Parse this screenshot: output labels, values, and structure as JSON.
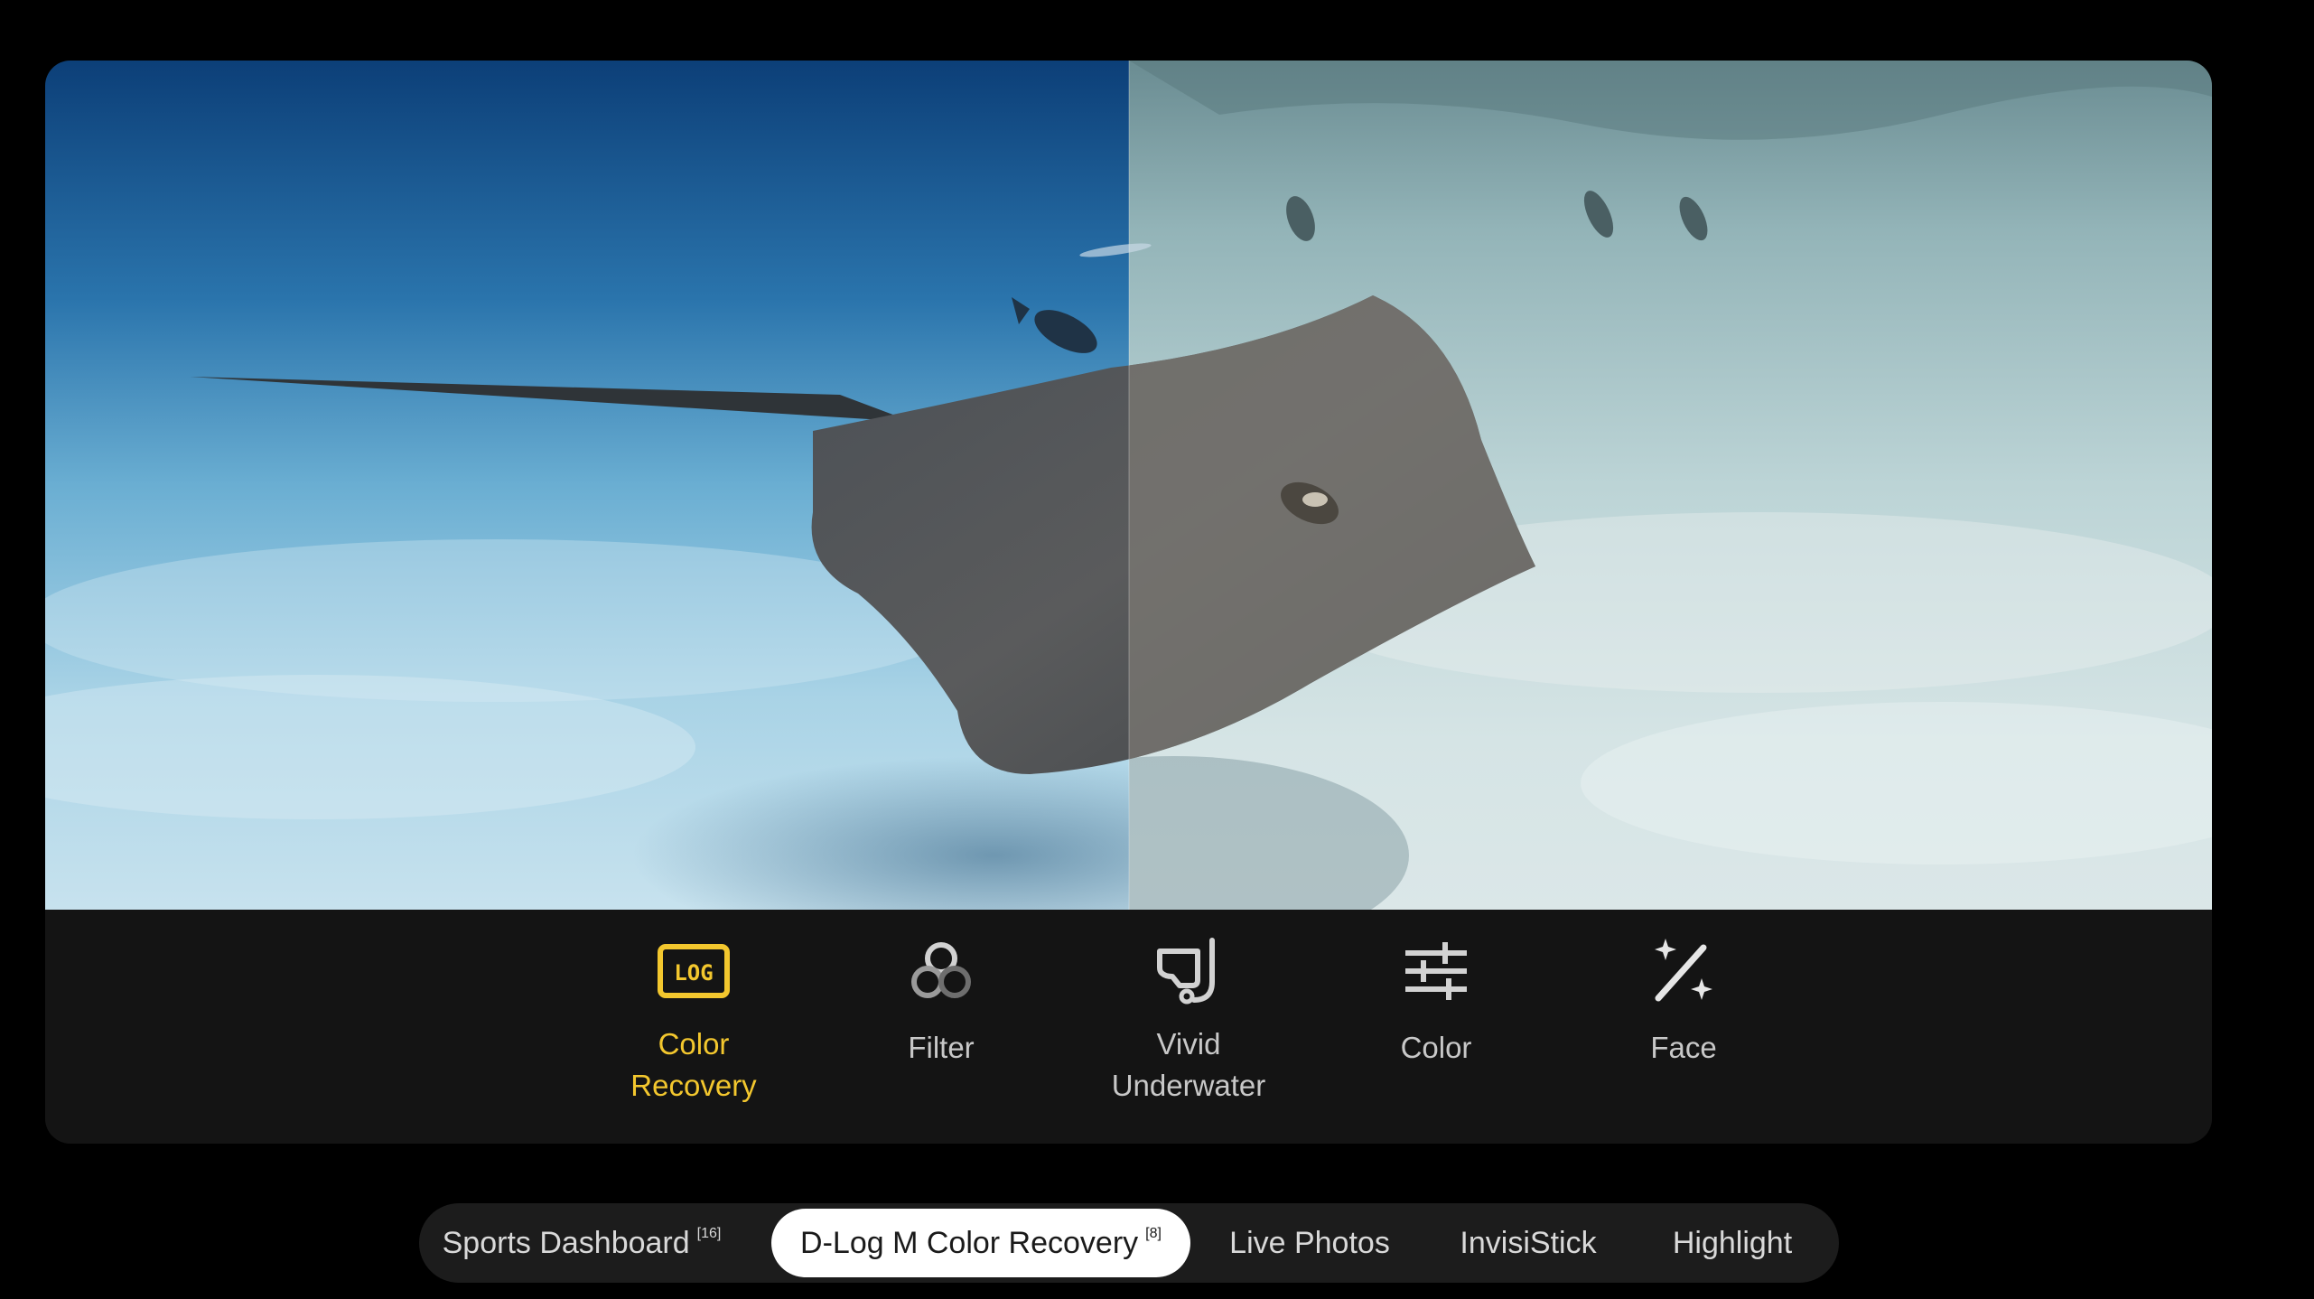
{
  "photo": {
    "subject": "stingray",
    "left_variant": "color-recovered",
    "right_variant": "d-log-m-flat"
  },
  "toolbar": {
    "items": [
      {
        "label": "Color\nRecovery",
        "icon": "log-icon",
        "active": true
      },
      {
        "label": "Filter",
        "icon": "filter-circles-icon",
        "active": false
      },
      {
        "label": "Vivid\nUnderwater",
        "icon": "underwater-mask-icon",
        "active": false
      },
      {
        "label": "Color",
        "icon": "sliders-icon",
        "active": false
      },
      {
        "label": "Face",
        "icon": "magic-wand-sparkle-icon",
        "active": false
      }
    ],
    "log_badge_text": "LOG"
  },
  "tabs": [
    {
      "label": "Sports Dashboard",
      "note": "[16]",
      "active": false
    },
    {
      "label": "D-Log M Color Recovery",
      "note": "[8]",
      "active": true
    },
    {
      "label": "Live Photos",
      "note": "",
      "active": false
    },
    {
      "label": "InvisiStick",
      "note": "",
      "active": false
    },
    {
      "label": "Highlight",
      "note": "",
      "active": false
    }
  ],
  "colors": {
    "accent_yellow": "#f3c72e",
    "toolbar_bg": "#141414",
    "tabbar_bg": "#1c1c1c",
    "active_tab_bg": "#ffffff"
  }
}
